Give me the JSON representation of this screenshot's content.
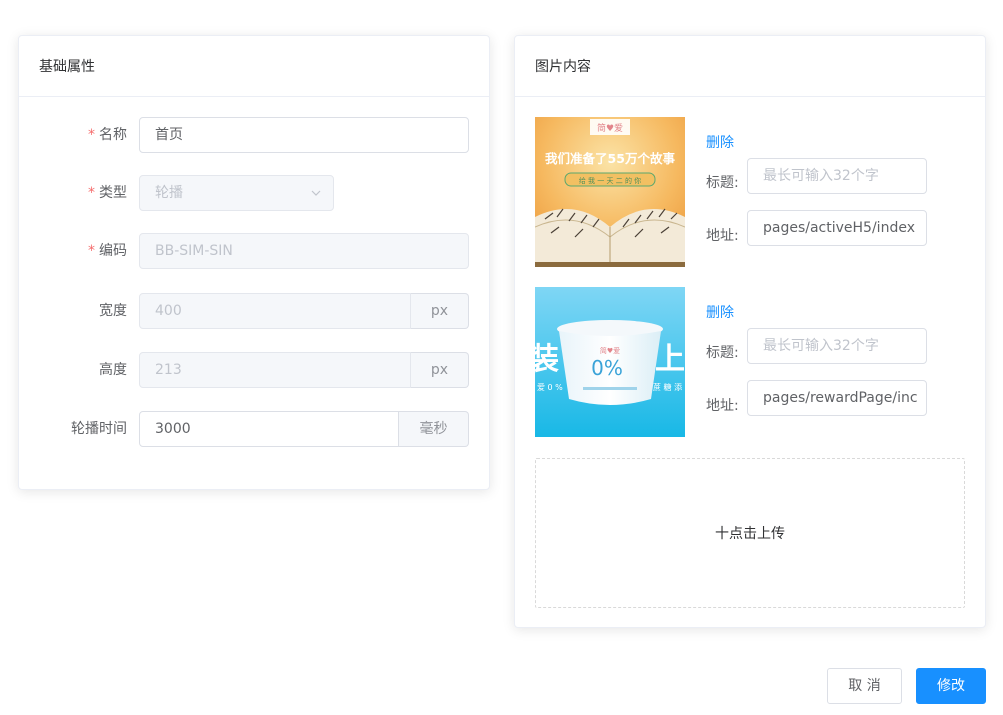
{
  "basic": {
    "title": "基础属性",
    "fields": {
      "name": {
        "label": "名称",
        "required": true,
        "value": "首页"
      },
      "type": {
        "label": "类型",
        "required": true,
        "value": "轮播"
      },
      "code": {
        "label": "编码",
        "required": true,
        "value": "BB-SIM-SIN"
      },
      "width": {
        "label": "宽度",
        "value": "400",
        "unit": "px"
      },
      "height": {
        "label": "高度",
        "value": "213",
        "unit": "px"
      },
      "interval": {
        "label": "轮播时间",
        "value": "3000",
        "unit": "毫秒"
      }
    }
  },
  "images": {
    "title": "图片内容",
    "items": [
      {
        "delete_label": "删除",
        "title_label": "标题:",
        "title_placeholder": "最长可输入32个字",
        "url_label": "地址:",
        "url_value": "pages/activeH5/index",
        "banner_text": "我们准备了55万个故事",
        "banner_sub": "给 我 一 天 二 的 你",
        "banner_logo": "简♥爱"
      },
      {
        "delete_label": "删除",
        "title_label": "标题:",
        "title_placeholder": "最长可输入32个字",
        "url_label": "地址:",
        "url_value": "pages/rewardPage/inc",
        "banner_left": "装",
        "banner_right": "上",
        "banner_cup": "0%",
        "banner_logo": "简♥爱",
        "banner_small_left": "爱 0 %",
        "banner_small_right": "蔗 糖 添"
      }
    ],
    "upload_label": "十点击上传"
  },
  "actions": {
    "cancel": "取 消",
    "submit": "修改"
  },
  "colors": {
    "primary": "#1890ff",
    "required": "#f56c6c"
  }
}
